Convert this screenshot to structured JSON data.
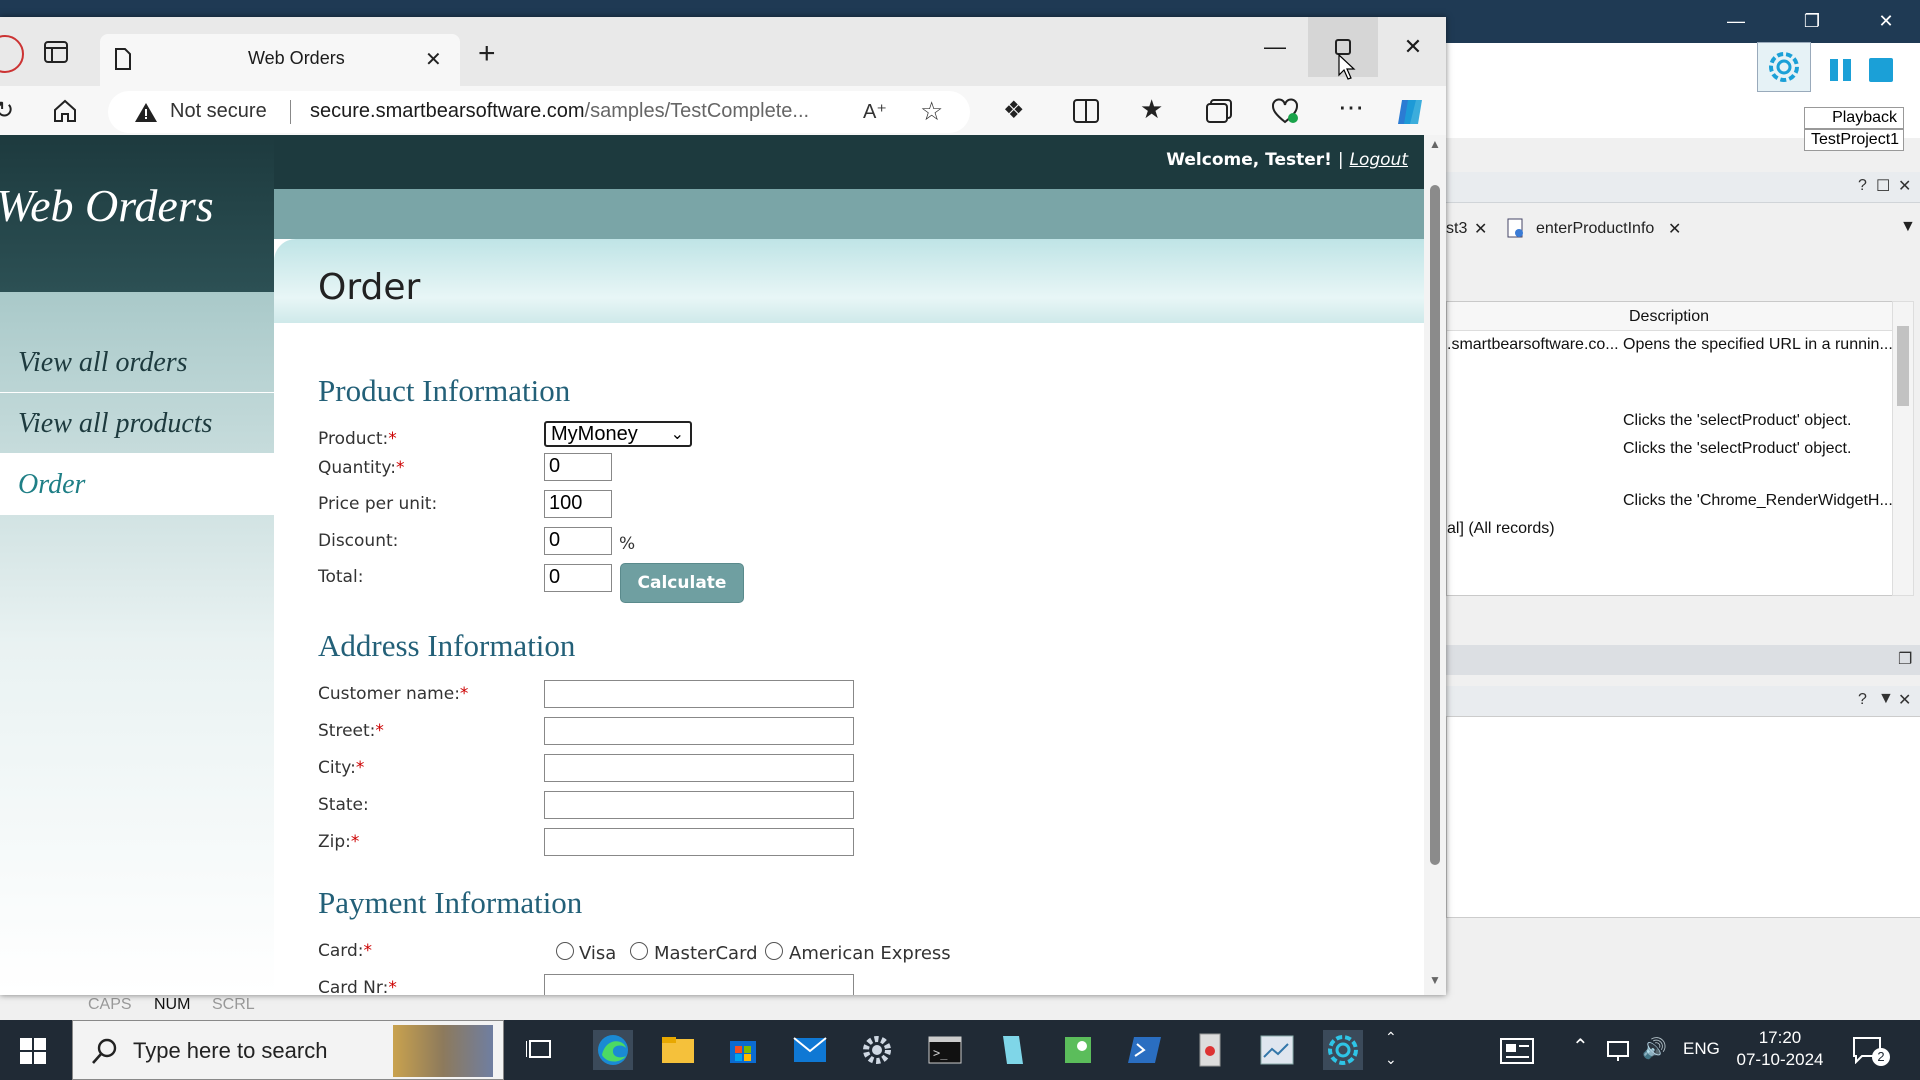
{
  "testcomplete": {
    "tooltip_playback": "Playback",
    "tooltip_project": "TestProject1",
    "tabs": [
      "st3",
      "enterProductInfo"
    ],
    "grid_header": "Description",
    "grid_rows": [
      {
        "col1": ".smartbearsoftware.co...",
        "col2": "Opens the specified URL in a runnin..."
      },
      {
        "col1": "",
        "col2": "Clicks the 'selectProduct' object."
      },
      {
        "col1": "",
        "col2": "Clicks the 'selectProduct' object."
      },
      {
        "col1": "",
        "col2": "Clicks the 'Chrome_RenderWidgetH..."
      },
      {
        "col1": "al] (All records)",
        "col2": ""
      }
    ],
    "status": {
      "caps": "CAPS",
      "num": "NUM",
      "scrl": "SCRL"
    }
  },
  "browser": {
    "tab_title": "Web Orders",
    "not_secure": "Not secure",
    "url_host": "secure.smartbearsoftware.com",
    "url_path": "/samples/TestComplete..."
  },
  "site": {
    "logo": "Web Orders",
    "welcome": "Welcome, Tester!",
    "separator": "|",
    "logout": "Logout",
    "nav": [
      "View all orders",
      "View all products",
      "Order"
    ],
    "page_title": "Order"
  },
  "form": {
    "product_heading": "Product Information",
    "product_label": "Product:",
    "product_value": "MyMoney",
    "quantity_label": "Quantity:",
    "quantity_value": "0",
    "price_label": "Price per unit:",
    "price_value": "100",
    "discount_label": "Discount:",
    "discount_value": "0",
    "percent": "%",
    "total_label": "Total:",
    "total_value": "0",
    "calculate": "Calculate",
    "address_heading": "Address Information",
    "customer_label": "Customer name:",
    "street_label": "Street:",
    "city_label": "City:",
    "state_label": "State:",
    "zip_label": "Zip:",
    "payment_heading": "Payment Information",
    "card_label": "Card:",
    "card_options": [
      "Visa",
      "MasterCard",
      "American Express"
    ],
    "cardnr_label": "Card Nr:",
    "required_mark": "*"
  },
  "taskbar": {
    "search_placeholder": "Type here to search",
    "language": "ENG",
    "time": "17:20",
    "date": "07-10-2024",
    "notification_count": "2"
  }
}
